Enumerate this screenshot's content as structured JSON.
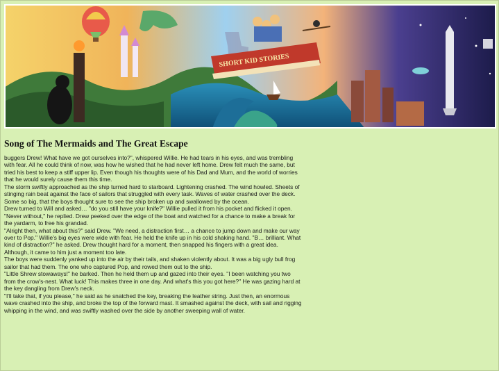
{
  "banner": {
    "book_title": "SHORT KID STORIES"
  },
  "story": {
    "title": "Song of The Mermaids and The Great Escape",
    "paragraphs": [
      "buggers Drew! What have we got ourselves into?\", whispered Willie. He had tears in his eyes, and was trembling with fear. All he could think of now, was how he wished that he had never left home. Drew felt much the same, but tried his best to keep a stiff upper lip. Even though his thoughts were of his Dad and Mum, and the world of worries that he would surely cause them this time.",
      "The storm swiftly approached as the ship turned hard to starboard. Lightening crashed. The wind howled. Sheets of stinging rain beat against the face of sailors that struggled with every task. Waves of water crashed over the deck. Some so big, that the boys thought sure to see the ship broken up and swallowed by the ocean.",
      "Drew turned to Will and asked… \"do you still have your knife?\" Willie pulled it from his pocket and flicked it open. \"Never without,\" he replied. Drew peeked over the edge of the boat and watched for a chance to make a break for the yardarm, to free his grandad.",
      "\"Alright then, what about this?\" said Drew. \"We need, a distraction first… a chance to jump down and make our way over to Pop.\" Willie's big eyes were wide with fear. He held the knife up in his cold shaking hand. \"B… brilliant. What kind of distraction?\" he asked. Drew thought hard for a moment, then snapped his fingers with a great idea. Although, it came to him just a moment too late.",
      "The boys were suddenly yanked up into the air by their tails, and shaken violently about. It was a big ugly bull frog sailor that had them. The one who captured Pop, and rowed them out to the ship.",
      "\"Little Shrew stowaways!\" he barked. Then he held them up and gazed into their eyes. \"I been watching you two from the crow's-nest. What luck! This makes three in one day. And what's this you got here?\" He was gazing hard at the key dangling from Drew's neck.",
      "\"I'll take that, if you please,\" he said as he snatched the key, breaking the leather string. Just then, an enormous wave crashed into the ship, and broke the top of the forward mast. It smashed against the deck, with sail and rigging whipping in the wind, and was swiftly washed over the side by another sweeping wall of water."
    ]
  }
}
